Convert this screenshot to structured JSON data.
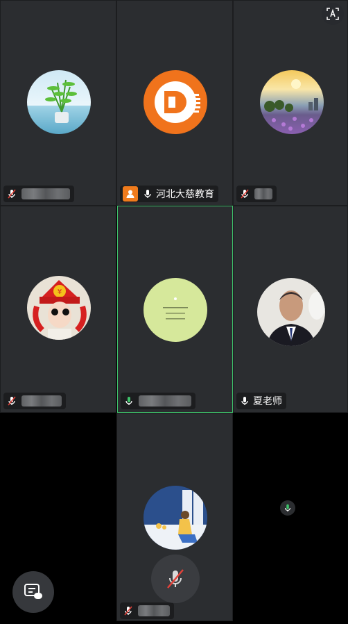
{
  "participants": [
    {
      "id": "p1",
      "name": "",
      "mic": "muted",
      "avatar": "bamboo-plant"
    },
    {
      "id": "p2",
      "name": "河北大慈教育",
      "mic": "on",
      "avatar": "orange-d-logo",
      "host": true
    },
    {
      "id": "p3",
      "name": "",
      "mic": "muted",
      "avatar": "sunset-flowers"
    },
    {
      "id": "p4",
      "name": "",
      "mic": "muted",
      "avatar": "red-hat-girl"
    },
    {
      "id": "p5",
      "name": "",
      "mic": "speaking",
      "avatar": "green-quote-circle",
      "active": true
    },
    {
      "id": "p6",
      "name": "夏老师",
      "mic": "on",
      "avatar": "man-portrait"
    },
    {
      "id": "p7",
      "name": "",
      "mic": "muted",
      "avatar": "girl-window-illustration"
    }
  ],
  "controls": {
    "translate_icon": "translate-icon",
    "chat_icon": "chat-bubble-icon",
    "mute_icon": "mic-off-icon",
    "speaking_icon": "mic-speaking-icon"
  },
  "colors": {
    "tile_bg": "#2b2d30",
    "active_border": "#3ec26a",
    "muted_red": "#e2423a",
    "host_orange": "#f07b1c"
  }
}
